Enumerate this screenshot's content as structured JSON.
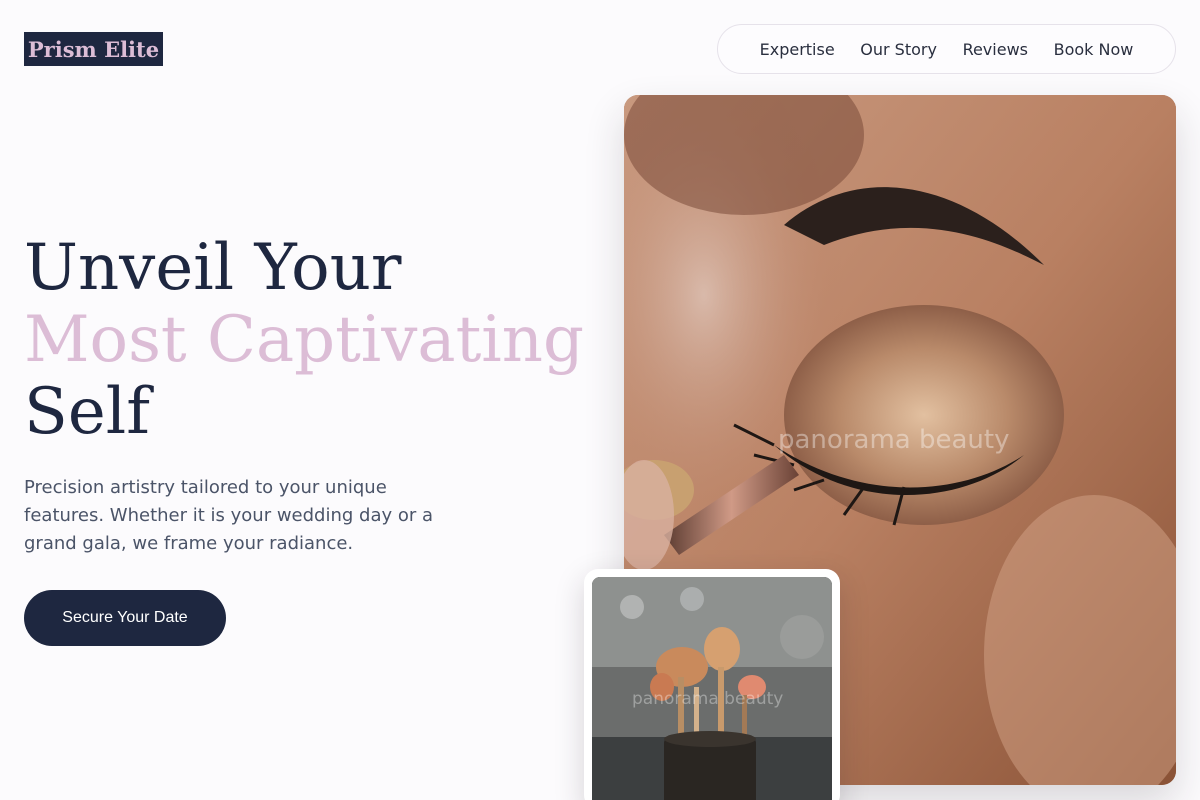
{
  "brand": {
    "logo_text": "Prism Elite"
  },
  "nav": {
    "items": [
      {
        "label": "Expertise"
      },
      {
        "label": "Our Story"
      },
      {
        "label": "Reviews"
      },
      {
        "label": "Book Now"
      }
    ]
  },
  "hero": {
    "headline_line1": "Unveil Your",
    "headline_line2": "Most Captivating",
    "headline_line3": "Self",
    "subtext": "Precision artistry tailored to your unique features. Whether it is your wedding day or a grand gala, we frame your radiance.",
    "cta_label": "Secure Your Date"
  },
  "images": {
    "main_watermark": "panorama beauty",
    "inset_watermark": "panorama beauty"
  },
  "colors": {
    "navy": "#1e2740",
    "accent_pink": "#dcbdd6",
    "background": "#fcfbfd",
    "body_text": "#4b5468"
  }
}
